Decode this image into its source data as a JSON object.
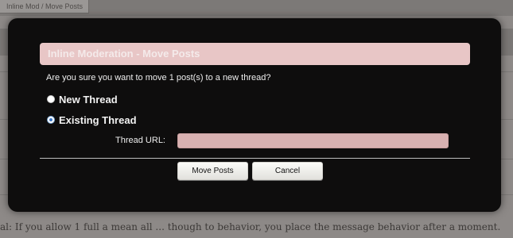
{
  "background": {
    "tab_label": "Inline Mod / Move Posts",
    "footer_text": "al: If you allow 1 full a mean all ... though to behavior, you place the message behavior after a moment."
  },
  "dialog": {
    "title": "Inline Moderation - Move Posts",
    "question": "Are you sure you want to move 1 post(s) to a new thread?",
    "options": [
      {
        "label": "New Thread",
        "selected": false
      },
      {
        "label": "Existing Thread",
        "selected": true
      }
    ],
    "thread_url": {
      "label": "Thread URL:",
      "value": "",
      "placeholder": ""
    },
    "buttons": {
      "move_label": "Move Posts",
      "cancel_label": "Cancel"
    }
  },
  "colors": {
    "overlay_bg": "#0e0d0d",
    "title_bar_bg": "#e8c6c6",
    "input_bg": "#d8b1b1",
    "radio_selected": "#3e78c4"
  }
}
